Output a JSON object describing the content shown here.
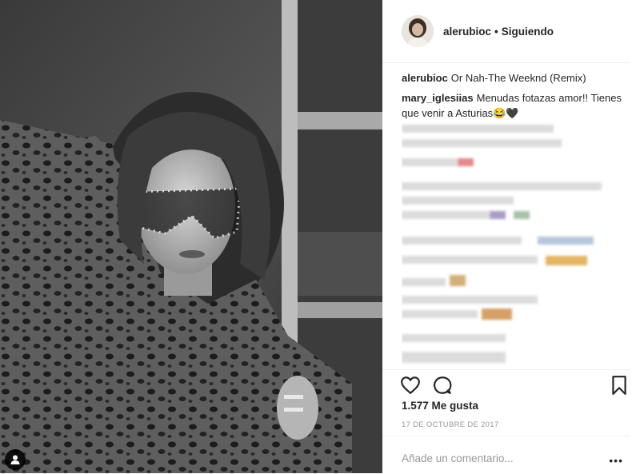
{
  "header": {
    "username": "alerubioc",
    "separator": "•",
    "follow_status": "Siguiendo"
  },
  "caption": {
    "username": "alerubioc",
    "text": "Or Nah-The Weeknd (Remix)"
  },
  "comments": [
    {
      "username": "mary_iglesiias",
      "text": "Menudas fotazas amor!! Tienes que venir a Asturias😂🖤"
    }
  ],
  "likes_text": "1.577 Me gusta",
  "date_text": "17 DE OCTUBRE DE 2017",
  "comment_input": {
    "placeholder": "Añade un comentario..."
  },
  "more_label": "•••",
  "icons": {
    "like": "heart-icon",
    "comment": "comment-bubble-icon",
    "save": "bookmark-icon",
    "tag": "person-tag-icon"
  },
  "colors": {
    "text": "#262626",
    "muted": "#999999",
    "border": "#efefef"
  }
}
